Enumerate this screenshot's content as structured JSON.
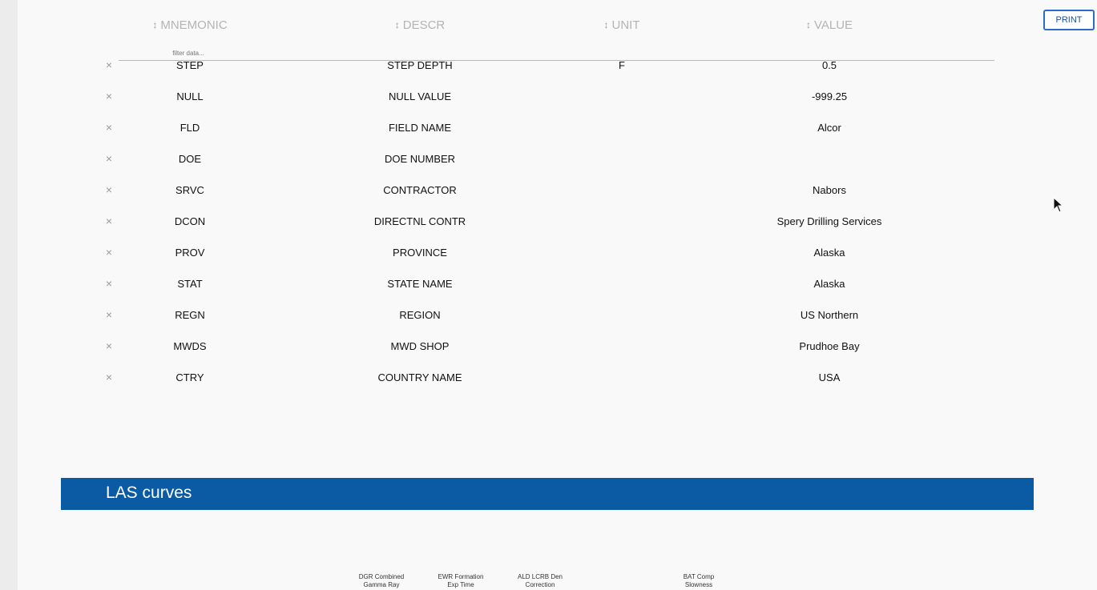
{
  "toolbar": {
    "print_label": "PRINT"
  },
  "table": {
    "columns": [
      {
        "label": "MNEMONIC"
      },
      {
        "label": "DESCR"
      },
      {
        "label": "UNIT"
      },
      {
        "label": "VALUE"
      }
    ],
    "filter_placeholder": "filter data...",
    "rows": [
      {
        "mnemonic": "STEP",
        "descr": "STEP DEPTH",
        "unit": "F",
        "value": "0.5"
      },
      {
        "mnemonic": "NULL",
        "descr": "NULL VALUE",
        "unit": "",
        "value": "-999.25"
      },
      {
        "mnemonic": "FLD",
        "descr": "FIELD NAME",
        "unit": "",
        "value": "Alcor"
      },
      {
        "mnemonic": "DOE",
        "descr": "DOE NUMBER",
        "unit": "",
        "value": ""
      },
      {
        "mnemonic": "SRVC",
        "descr": "CONTRACTOR",
        "unit": "",
        "value": "Nabors"
      },
      {
        "mnemonic": "DCON",
        "descr": "DIRECTNL CONTR",
        "unit": "",
        "value": "Spery Drilling Services"
      },
      {
        "mnemonic": "PROV",
        "descr": "PROVINCE",
        "unit": "",
        "value": "Alaska"
      },
      {
        "mnemonic": "STAT",
        "descr": "STATE NAME",
        "unit": "",
        "value": "Alaska"
      },
      {
        "mnemonic": "REGN",
        "descr": "REGION",
        "unit": "",
        "value": "US Northern"
      },
      {
        "mnemonic": "MWDS",
        "descr": "MWD SHOP",
        "unit": "",
        "value": "Prudhoe Bay"
      },
      {
        "mnemonic": "CTRY",
        "descr": "COUNTRY NAME",
        "unit": "",
        "value": "USA"
      }
    ],
    "remove_glyph": "×",
    "sort_glyph": "↕"
  },
  "las_curves": {
    "title": "LAS curves",
    "curve_labels": [
      "DGR Combined\nGamma Ray",
      "EWR Formation\nExp Time",
      "ALD LCRB Den\nCorrection",
      "BAT Comp\nSlowness"
    ]
  },
  "colors": {
    "accent": "#0b5aa4",
    "button_border": "#2c6bc9"
  }
}
